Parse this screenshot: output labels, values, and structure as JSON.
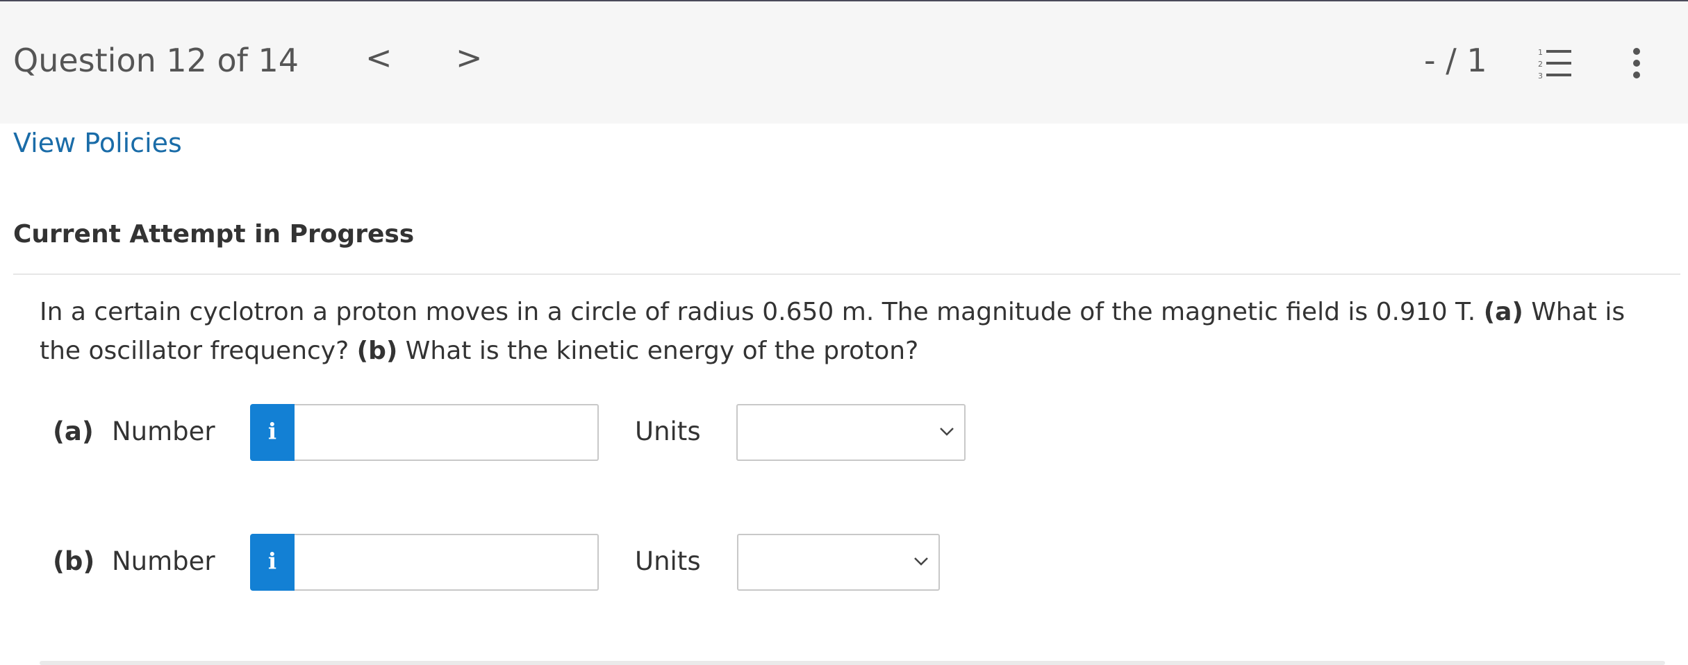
{
  "header": {
    "question_title": "Question 12 of 14",
    "prev_icon": "chevron-left-icon",
    "next_icon": "chevron-right-icon",
    "prev_glyph": "<",
    "next_glyph": ">",
    "score": "- / 1",
    "list_icon": "numbered-list-icon",
    "more_icon": "more-vertical-icon"
  },
  "links": {
    "view_policies": "View Policies"
  },
  "attempt_heading": "Current Attempt in Progress",
  "question": {
    "text_part1": "In a certain cyclotron a proton moves in a circle of radius 0.650 m. The magnitude of the magnetic field is 0.910 T. ",
    "label_a": "(a)",
    "text_part2": " What is the oscillator frequency? ",
    "label_b": "(b)",
    "text_part3": " What is the kinetic energy of the proton?"
  },
  "answers": [
    {
      "part_label": "(a)",
      "number_label": "Number",
      "info_glyph": "i",
      "info_icon": "info-icon",
      "number_value": "",
      "units_label": "Units",
      "units_selected": ""
    },
    {
      "part_label": "(b)",
      "number_label": "Number",
      "info_glyph": "i",
      "info_icon": "info-icon",
      "number_value": "",
      "units_label": "Units",
      "units_selected": ""
    }
  ],
  "colors": {
    "link": "#1a6ca8",
    "info_button": "#1380d4",
    "header_bg": "#f6f6f6",
    "text": "#333333"
  }
}
